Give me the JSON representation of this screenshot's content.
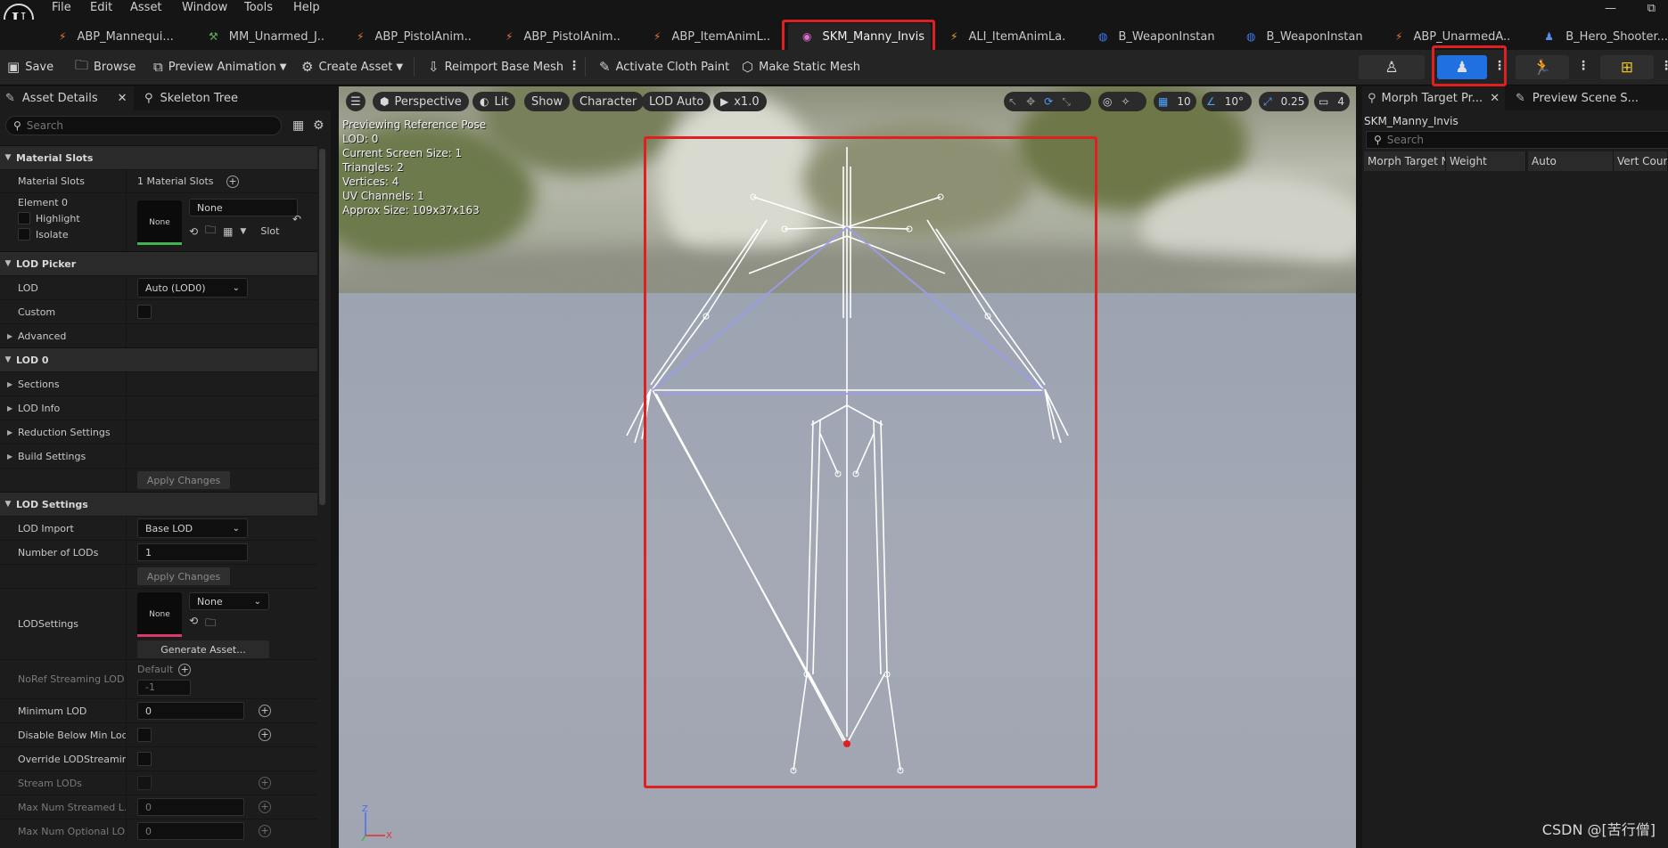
{
  "menu": [
    "File",
    "Edit",
    "Asset",
    "Window",
    "Tools",
    "Help"
  ],
  "window_controls": {
    "minimize": "—",
    "maximize": "⧉"
  },
  "doc_tabs": [
    {
      "label": "ABP_Mannequi...",
      "suffix": "•",
      "icon": "anim-blueprint-icon",
      "color": "#e07b35"
    },
    {
      "label": "MM_Unarmed_J...",
      "icon": "montage-icon",
      "color": "#59b15a"
    },
    {
      "label": "ABP_PistolAnim...",
      "icon": "anim-blueprint-icon",
      "color": "#e07b35"
    },
    {
      "label": "ABP_PistolAnim...",
      "icon": "anim-blueprint-icon",
      "color": "#e07b35"
    },
    {
      "label": "ABP_ItemAnimL...",
      "icon": "anim-blueprint-icon",
      "color": "#e07b35"
    },
    {
      "label": "SKM_Manny_Invis",
      "icon": "skeletal-mesh-icon",
      "color": "#e26bd5",
      "active": true
    },
    {
      "label": "ALI_ItemAnimLa...",
      "icon": "anim-layer-icon",
      "color": "#e0a035"
    },
    {
      "label": "B_WeaponInstan...",
      "icon": "blueprint-icon",
      "color": "#3f7cf0"
    },
    {
      "label": "B_WeaponInstan...",
      "icon": "blueprint-icon",
      "color": "#3f7cf0"
    },
    {
      "label": "ABP_UnarmedA...",
      "icon": "anim-blueprint-icon",
      "color": "#e07b35"
    },
    {
      "label": "B_Hero_Shooter...",
      "icon": "character-icon",
      "color": "#5d8cf0"
    }
  ],
  "toolbar": {
    "save": "Save",
    "browse": "Browse",
    "preview_animation": "Preview Animation",
    "create_asset": "Create Asset",
    "reimport": "Reimport Base Mesh",
    "cloth_paint": "Activate Cloth Paint",
    "static_mesh": "Make Static Mesh"
  },
  "left_panel": {
    "tab_details": "Asset Details",
    "tab_skeleton": "Skeleton Tree",
    "search_placeholder": "Search",
    "material_slots_cat": "Material Slots",
    "material_slots_label": "Material Slots",
    "material_slots_value": "1 Material Slots",
    "element0": "Element 0",
    "highlight": "Highlight",
    "isolate": "Isolate",
    "material_thumb": "None",
    "material_combo": "None",
    "slot": "Slot",
    "lod_picker_cat": "LOD Picker",
    "lod_label": "LOD",
    "lod_value": "Auto (LOD0)",
    "custom_label": "Custom",
    "advanced": "Advanced",
    "lod0_cat": "LOD 0",
    "sections": "Sections",
    "lod_info": "LOD Info",
    "reduction": "Reduction Settings",
    "build": "Build Settings",
    "apply_changes": "Apply Changes",
    "lod_settings_cat": "LOD Settings",
    "lod_import_label": "LOD Import",
    "lod_import_value": "Base LOD",
    "num_lods_label": "Number of LODs",
    "num_lods_value": "1",
    "apply_changes2": "Apply Changes",
    "lodsettings_label": "LODSettings",
    "lodsettings_thumb": "None",
    "lodsettings_combo": "None",
    "generate_asset": "Generate Asset...",
    "noref_label": "NoRef Streaming LOD B",
    "noref_default": "Default",
    "noref_value": "-1",
    "min_lod_label": "Minimum LOD",
    "min_lod_value": "0",
    "disable_below_label": "Disable Below Min Lod...",
    "override_label": "Override LODStreamin...",
    "stream_lods_label": "Stream LODs",
    "max_streamed_label": "Max Num Streamed L...",
    "max_streamed_value": "0",
    "max_optional_label": "Max Num Optional LO...",
    "max_optional_value": "0"
  },
  "viewport": {
    "perspective": "Perspective",
    "lit": "Lit",
    "show": "Show",
    "character": "Character",
    "lod_auto": "LOD Auto",
    "play_speed": "x1.0",
    "grid_snap": "10",
    "rot_snap": "10°",
    "scale_snap": "0.25",
    "cam_speed": "4",
    "info": [
      "Previewing Reference Pose",
      "LOD: 0",
      "Current Screen Size: 1",
      "Triangles: 2",
      "Vertices: 4",
      "UV Channels: 1",
      "Approx Size: 109x37x163"
    ],
    "axis_z": "Z",
    "axis_x": "X"
  },
  "right_panel": {
    "tab_morph": "Morph Target Pr...",
    "tab_scene": "Preview Scene S...",
    "asset_name": "SKM_Manny_Invis",
    "search_placeholder": "Search",
    "columns": [
      "Morph Target N",
      "Weight",
      "Auto",
      "Vert Count"
    ]
  },
  "watermark": "CSDN @[苦行僧]",
  "colors": {
    "highlight_red": "#e02020",
    "accent_blue": "#1f70e0",
    "bone_white": "#ffffff",
    "bone_blue": "#8f8ff0"
  }
}
